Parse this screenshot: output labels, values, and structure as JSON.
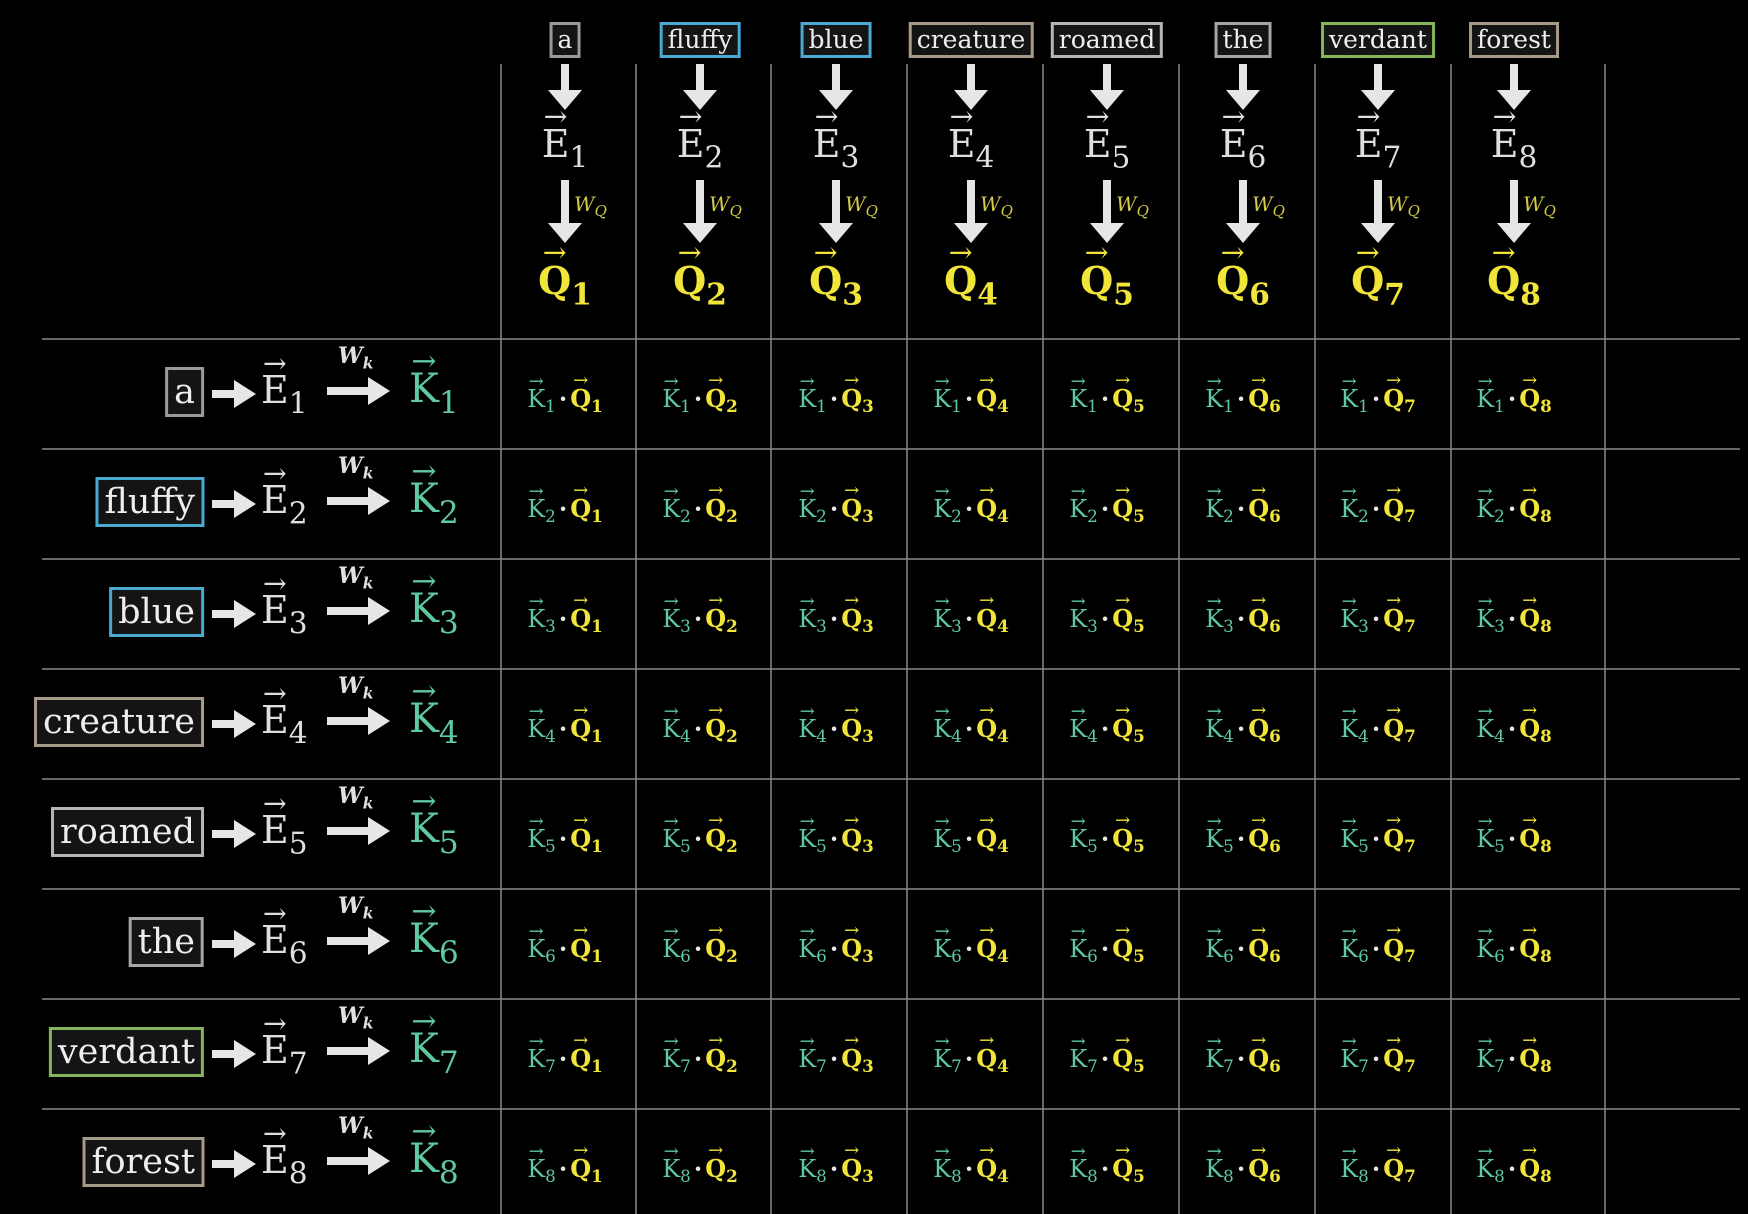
{
  "tokens": [
    {
      "word": "a",
      "color": "#9a9a9a"
    },
    {
      "word": "fluffy",
      "color": "#4aa9d1"
    },
    {
      "word": "blue",
      "color": "#4aa9d1"
    },
    {
      "word": "creature",
      "color": "#a89a88"
    },
    {
      "word": "roamed",
      "color": "#b5b5b5"
    },
    {
      "word": "the",
      "color": "#a5a5a5"
    },
    {
      "word": "verdant",
      "color": "#84b55c"
    },
    {
      "word": "forest",
      "color": "#a89a88"
    }
  ],
  "symbols": {
    "embedding": "E",
    "query": "Q",
    "key": "K",
    "query_weight": "W",
    "query_weight_sub": "Q",
    "key_weight": "W",
    "key_weight_sub": "k",
    "dot": "·"
  },
  "colors": {
    "background": "#000000",
    "grid_line": "#8a8a8a",
    "query": "#f1e53a",
    "key": "#5fc9a1",
    "embedding": "#dedede"
  }
}
